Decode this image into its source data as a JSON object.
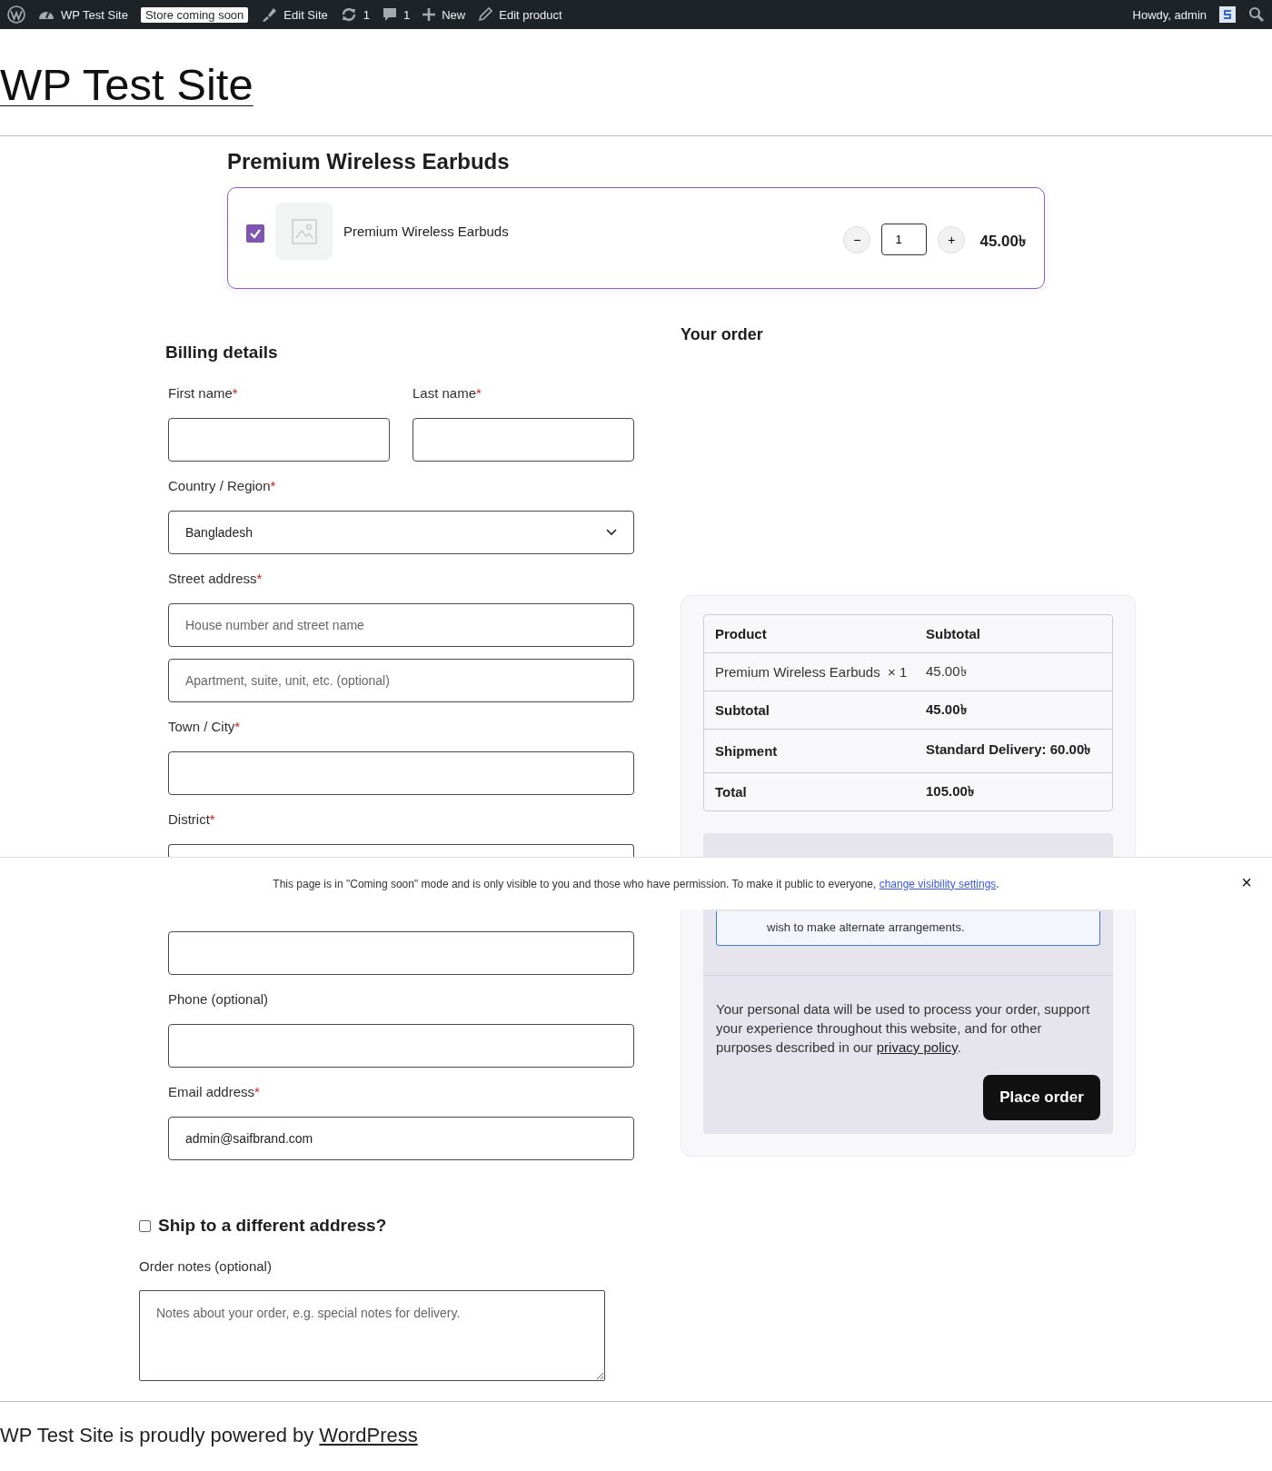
{
  "admin_bar": {
    "site": "WP Test Site",
    "badge": "Store coming soon",
    "items": [
      {
        "kind": "edit-site",
        "label": "Edit Site"
      },
      {
        "kind": "updates",
        "label": "1"
      },
      {
        "kind": "comments",
        "label": "1"
      },
      {
        "kind": "new",
        "label": "New"
      },
      {
        "kind": "edit",
        "label": "Edit product"
      }
    ],
    "greeting": "Howdy, admin"
  },
  "site_title": "WP Test Site",
  "product_section": {
    "title": "Premium Wireless Earbuds",
    "item": {
      "name": "Premium Wireless Earbuds",
      "checked": true,
      "minus": "−",
      "quantity": "1",
      "plus": "+",
      "price": "45.00৳"
    }
  },
  "billing": {
    "title": "Billing details",
    "name_fields": [
      {
        "kind": "text",
        "label": "First name",
        "mark": "*"
      },
      {
        "kind": "text",
        "label": "Last name",
        "mark": "*"
      }
    ],
    "fields": [
      {
        "kind": "select",
        "label": "Country / Region",
        "mark": "*",
        "value": "Bangladesh"
      },
      {
        "kind": "text",
        "label": "Street address",
        "mark": "*",
        "placeholder": "House number and street name"
      },
      {
        "kind": "text",
        "placeholder": "Apartment, suite, unit, etc. (optional)"
      },
      {
        "kind": "text",
        "label": "Town / City",
        "mark": "*"
      },
      {
        "kind": "text-top",
        "label": "District",
        "mark": "*"
      },
      {
        "kind": "text"
      },
      {
        "kind": "text",
        "label": "Phone (optional)"
      },
      {
        "kind": "text",
        "label": "Email address",
        "mark": "*",
        "value": "admin@saifbrand.com"
      }
    ]
  },
  "order": {
    "title": "Your order",
    "columns": [
      "Product",
      "Subtotal"
    ],
    "rows": [
      {
        "kind": "item",
        "label": "Premium Wireless Earbuds",
        "qty": "× 1",
        "value": "45.00৳"
      },
      {
        "kind": "total",
        "label": "Subtotal",
        "value": "45.00৳"
      },
      {
        "kind": "shipping",
        "label": "Shipment",
        "value": "Standard Delivery: 60.00৳"
      },
      {
        "kind": "total",
        "label": "Total",
        "value": "105.00৳"
      }
    ],
    "payment_note": "wish to make alternate arrangements.",
    "privacy": {
      "before": "Your personal data will be used to process your order, support your experience throughout this website, and for other purposes described in our",
      "link": "privacy policy",
      "after": "."
    },
    "button": "Place order"
  },
  "shipping": {
    "label": "Ship to a different address?",
    "checked": false
  },
  "notes": {
    "label": "Order notes (optional)",
    "placeholder": "Notes about your order, e.g. special notes for delivery."
  },
  "footer": {
    "text": "WP Test Site is proudly powered by",
    "link": "WordPress"
  },
  "notice": {
    "text": "This page is in \"Coming soon\" mode and is only visible to you and those who have permission. To make it public to everyone,",
    "link": "change visibility settings",
    "after": ".",
    "close": "×"
  }
}
